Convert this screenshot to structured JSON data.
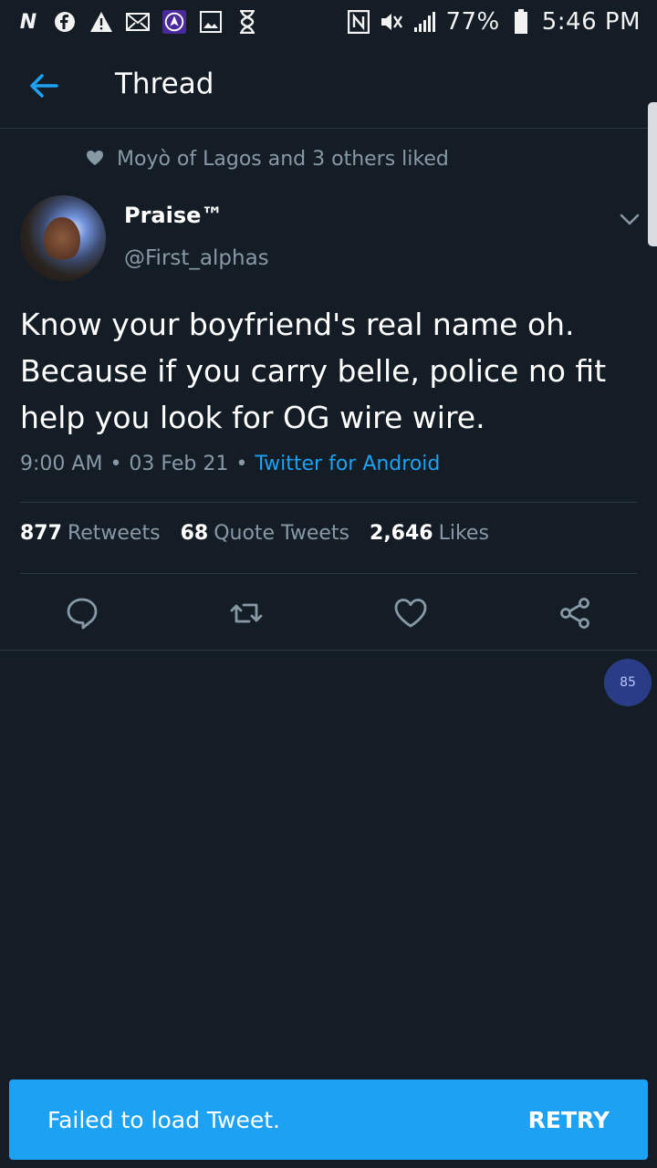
{
  "status_bar": {
    "battery": "77%",
    "time": "5:46 PM",
    "left_icons": [
      "n-app-icon",
      "circle-f-icon",
      "warning-icon",
      "mail-icon",
      "navigation-app-icon",
      "gallery-icon",
      "hourglass-icon"
    ],
    "right_icons": [
      "nfc-icon",
      "mute-icon",
      "signal-icon",
      "battery-icon"
    ]
  },
  "app_bar": {
    "title": "Thread"
  },
  "tweet": {
    "social_context": "Moyò of Lagos and 3 others liked",
    "author_name": "Praise™",
    "author_handle": "@First_alphas",
    "text": "Know your boyfriend's real name oh. Because if you carry belle, police no fit help you look for OG wire wire.",
    "time": "9:00 AM",
    "date": "03 Feb 21",
    "separator": "•",
    "source": "Twitter for Android"
  },
  "stats": {
    "retweets_count": "877",
    "retweets_label": "Retweets",
    "quotes_count": "68",
    "quotes_label": "Quote Tweets",
    "likes_count": "2,646",
    "likes_label": "Likes"
  },
  "floating_badge": {
    "value": "85"
  },
  "snackbar": {
    "message": "Failed to load Tweet.",
    "action": "RETRY"
  },
  "colors": {
    "background": "#141d26",
    "accent": "#1da1f2",
    "secondary_text": "#8899a6",
    "divider": "#2b3744"
  }
}
